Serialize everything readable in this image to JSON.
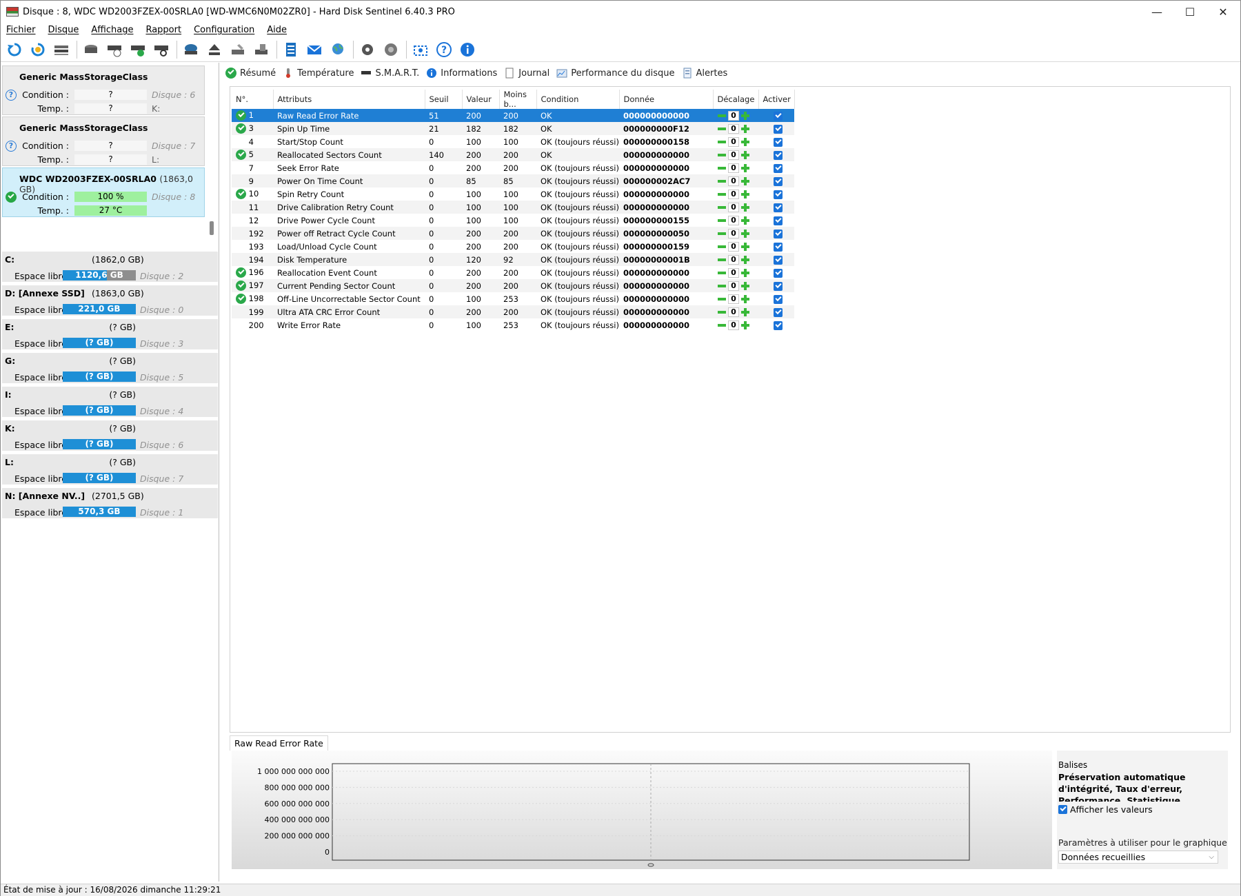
{
  "window": {
    "title": "Disque : 8, WDC WD2003FZEX-00SRLA0 [WD-WMC6N0M02ZR0]  -  Hard Disk Sentinel 6.40.3 PRO",
    "minimize_label": "—",
    "maximize_label": "☐",
    "close_label": "✕"
  },
  "menu": [
    "Fichier",
    "Disque",
    "Affichage",
    "Rapport",
    "Configuration",
    "Aide"
  ],
  "toolbar": {
    "buttons": [
      "refresh-icon",
      "refresh-warning-icon",
      "disk-list-icon",
      "disk-icon",
      "disk-clock-icon",
      "disk-check-icon",
      "disk-search-icon",
      "drive-icon",
      "eject-icon",
      "drive-tools-icon",
      "drive-surface-icon",
      "report-icon",
      "mail-icon",
      "globe-icon",
      "settings-icon",
      "sound-icon",
      "screenshot-icon",
      "help-icon",
      "info-icon"
    ]
  },
  "disks": [
    {
      "name": "Generic MassStorageClass",
      "size": "",
      "condition": "?",
      "temp": "?",
      "disk": "Disque : 6",
      "letter": "K:",
      "status": "unknown",
      "cond_label": "Condition :",
      "temp_label": "Temp. :"
    },
    {
      "name": "Generic MassStorageClass",
      "size": "",
      "condition": "?",
      "temp": "?",
      "disk": "Disque : 7",
      "letter": "L:",
      "status": "unknown",
      "cond_label": "Condition :",
      "temp_label": "Temp. :"
    },
    {
      "name": "WDC WD2003FZEX-00SRLA0",
      "size": "(1863,0 GB)",
      "condition": "100 %",
      "temp": "27 °C",
      "disk": "Disque : 8",
      "letter": "",
      "status": "ok",
      "cond_label": "Condition :",
      "temp_label": "Temp. :"
    }
  ],
  "volumes": [
    {
      "letter": "C:",
      "size": "(1862,0 GB)",
      "label": "Espace libre",
      "free": "1120,6 GB",
      "fill": 0.6,
      "disk": "Disque : 2"
    },
    {
      "letter": "D: [Annexe SSD]",
      "size": "(1863,0 GB)",
      "label": "Espace libre",
      "free": "221,0 GB",
      "fill": 1.0,
      "disk": "Disque : 0"
    },
    {
      "letter": "E:",
      "size": "(? GB)",
      "label": "Espace libre",
      "free": "(? GB)",
      "fill": 1.0,
      "disk": "Disque : 3"
    },
    {
      "letter": "G:",
      "size": "(? GB)",
      "label": "Espace libre",
      "free": "(? GB)",
      "fill": 1.0,
      "disk": "Disque : 5"
    },
    {
      "letter": "I:",
      "size": "(? GB)",
      "label": "Espace libre",
      "free": "(? GB)",
      "fill": 1.0,
      "disk": "Disque : 4"
    },
    {
      "letter": "K:",
      "size": "(? GB)",
      "label": "Espace libre",
      "free": "(? GB)",
      "fill": 1.0,
      "disk": "Disque : 6"
    },
    {
      "letter": "L:",
      "size": "(? GB)",
      "label": "Espace libre",
      "free": "(? GB)",
      "fill": 1.0,
      "disk": "Disque : 7"
    },
    {
      "letter": "N: [Annexe NV..]",
      "size": "(2701,5 GB)",
      "label": "Espace libre",
      "free": "570,3 GB",
      "fill": 1.0,
      "disk": "Disque : 1"
    }
  ],
  "tabs": [
    {
      "label": "Résumé",
      "icon": "check-circle-icon"
    },
    {
      "label": "Température",
      "icon": "thermometer-icon"
    },
    {
      "label": "S.M.A.R.T.",
      "icon": "disk-icon"
    },
    {
      "label": "Informations",
      "icon": "info-icon"
    },
    {
      "label": "Journal",
      "icon": "document-icon"
    },
    {
      "label": "Performance du disque",
      "icon": "chart-icon"
    },
    {
      "label": "Alertes",
      "icon": "alert-doc-icon"
    }
  ],
  "smart": {
    "columns": [
      "N°.",
      "Attributs",
      "Seuil",
      "Valeur",
      "Moins b...",
      "Condition",
      "Donnée",
      "Décalage",
      "Activer"
    ],
    "rows": [
      {
        "ok": true,
        "id": "1",
        "attr": "Raw Read Error Rate",
        "seuil": "51",
        "valeur": "200",
        "moins": "200",
        "cond": "OK",
        "data": "000000000000",
        "offset": "0"
      },
      {
        "ok": true,
        "id": "3",
        "attr": "Spin Up Time",
        "seuil": "21",
        "valeur": "182",
        "moins": "182",
        "cond": "OK",
        "data": "000000000F12",
        "offset": "0"
      },
      {
        "ok": false,
        "id": "4",
        "attr": "Start/Stop Count",
        "seuil": "0",
        "valeur": "100",
        "moins": "100",
        "cond": "OK (toujours réussi)",
        "data": "000000000158",
        "offset": "0"
      },
      {
        "ok": true,
        "id": "5",
        "attr": "Reallocated Sectors Count",
        "seuil": "140",
        "valeur": "200",
        "moins": "200",
        "cond": "OK",
        "data": "000000000000",
        "offset": "0"
      },
      {
        "ok": false,
        "id": "7",
        "attr": "Seek Error Rate",
        "seuil": "0",
        "valeur": "200",
        "moins": "200",
        "cond": "OK (toujours réussi)",
        "data": "000000000000",
        "offset": "0"
      },
      {
        "ok": false,
        "id": "9",
        "attr": "Power On Time Count",
        "seuil": "0",
        "valeur": "85",
        "moins": "85",
        "cond": "OK (toujours réussi)",
        "data": "000000002AC7",
        "offset": "0"
      },
      {
        "ok": true,
        "id": "10",
        "attr": "Spin Retry Count",
        "seuil": "0",
        "valeur": "100",
        "moins": "100",
        "cond": "OK (toujours réussi)",
        "data": "000000000000",
        "offset": "0"
      },
      {
        "ok": false,
        "id": "11",
        "attr": "Drive Calibration Retry Count",
        "seuil": "0",
        "valeur": "100",
        "moins": "100",
        "cond": "OK (toujours réussi)",
        "data": "000000000000",
        "offset": "0"
      },
      {
        "ok": false,
        "id": "12",
        "attr": "Drive Power Cycle Count",
        "seuil": "0",
        "valeur": "100",
        "moins": "100",
        "cond": "OK (toujours réussi)",
        "data": "000000000155",
        "offset": "0"
      },
      {
        "ok": false,
        "id": "192",
        "attr": "Power off Retract Cycle Count",
        "seuil": "0",
        "valeur": "200",
        "moins": "200",
        "cond": "OK (toujours réussi)",
        "data": "000000000050",
        "offset": "0"
      },
      {
        "ok": false,
        "id": "193",
        "attr": "Load/Unload Cycle Count",
        "seuil": "0",
        "valeur": "200",
        "moins": "200",
        "cond": "OK (toujours réussi)",
        "data": "000000000159",
        "offset": "0"
      },
      {
        "ok": false,
        "id": "194",
        "attr": "Disk Temperature",
        "seuil": "0",
        "valeur": "120",
        "moins": "92",
        "cond": "OK (toujours réussi)",
        "data": "00000000001B",
        "offset": "0"
      },
      {
        "ok": true,
        "id": "196",
        "attr": "Reallocation Event Count",
        "seuil": "0",
        "valeur": "200",
        "moins": "200",
        "cond": "OK (toujours réussi)",
        "data": "000000000000",
        "offset": "0"
      },
      {
        "ok": true,
        "id": "197",
        "attr": "Current Pending Sector Count",
        "seuil": "0",
        "valeur": "200",
        "moins": "200",
        "cond": "OK (toujours réussi)",
        "data": "000000000000",
        "offset": "0"
      },
      {
        "ok": true,
        "id": "198",
        "attr": "Off-Line Uncorrectable Sector Count",
        "seuil": "0",
        "valeur": "100",
        "moins": "253",
        "cond": "OK (toujours réussi)",
        "data": "000000000000",
        "offset": "0"
      },
      {
        "ok": false,
        "id": "199",
        "attr": "Ultra ATA CRC Error Count",
        "seuil": "0",
        "valeur": "200",
        "moins": "200",
        "cond": "OK (toujours réussi)",
        "data": "000000000000",
        "offset": "0"
      },
      {
        "ok": false,
        "id": "200",
        "attr": "Write Error Rate",
        "seuil": "0",
        "valeur": "100",
        "moins": "253",
        "cond": "OK (toujours réussi)",
        "data": "000000000000",
        "offset": "0"
      }
    ]
  },
  "graph": {
    "title": "Raw Read Error Rate",
    "balises_label": "Balises",
    "balises_text": "Préservation automatique d'intégrité, Taux d'erreur, Performance, Statistique, Critique",
    "show_values_label": "Afficher les valeurs",
    "param_label": "Paramètres à utiliser pour le graphique",
    "param_value": "Données recueillies"
  },
  "chart_data": {
    "type": "line",
    "title": "Raw Read Error Rate",
    "y_ticks": [
      "1 000 000 000 000",
      "800 000 000 000",
      "600 000 000 000",
      "400 000 000 000",
      "200 000 000 000",
      "0"
    ],
    "ylim": [
      0,
      1000000000000
    ],
    "series": [],
    "grid": true
  },
  "status": "État de mise à jour : 16/08/2026 dimanche 11:29:21"
}
